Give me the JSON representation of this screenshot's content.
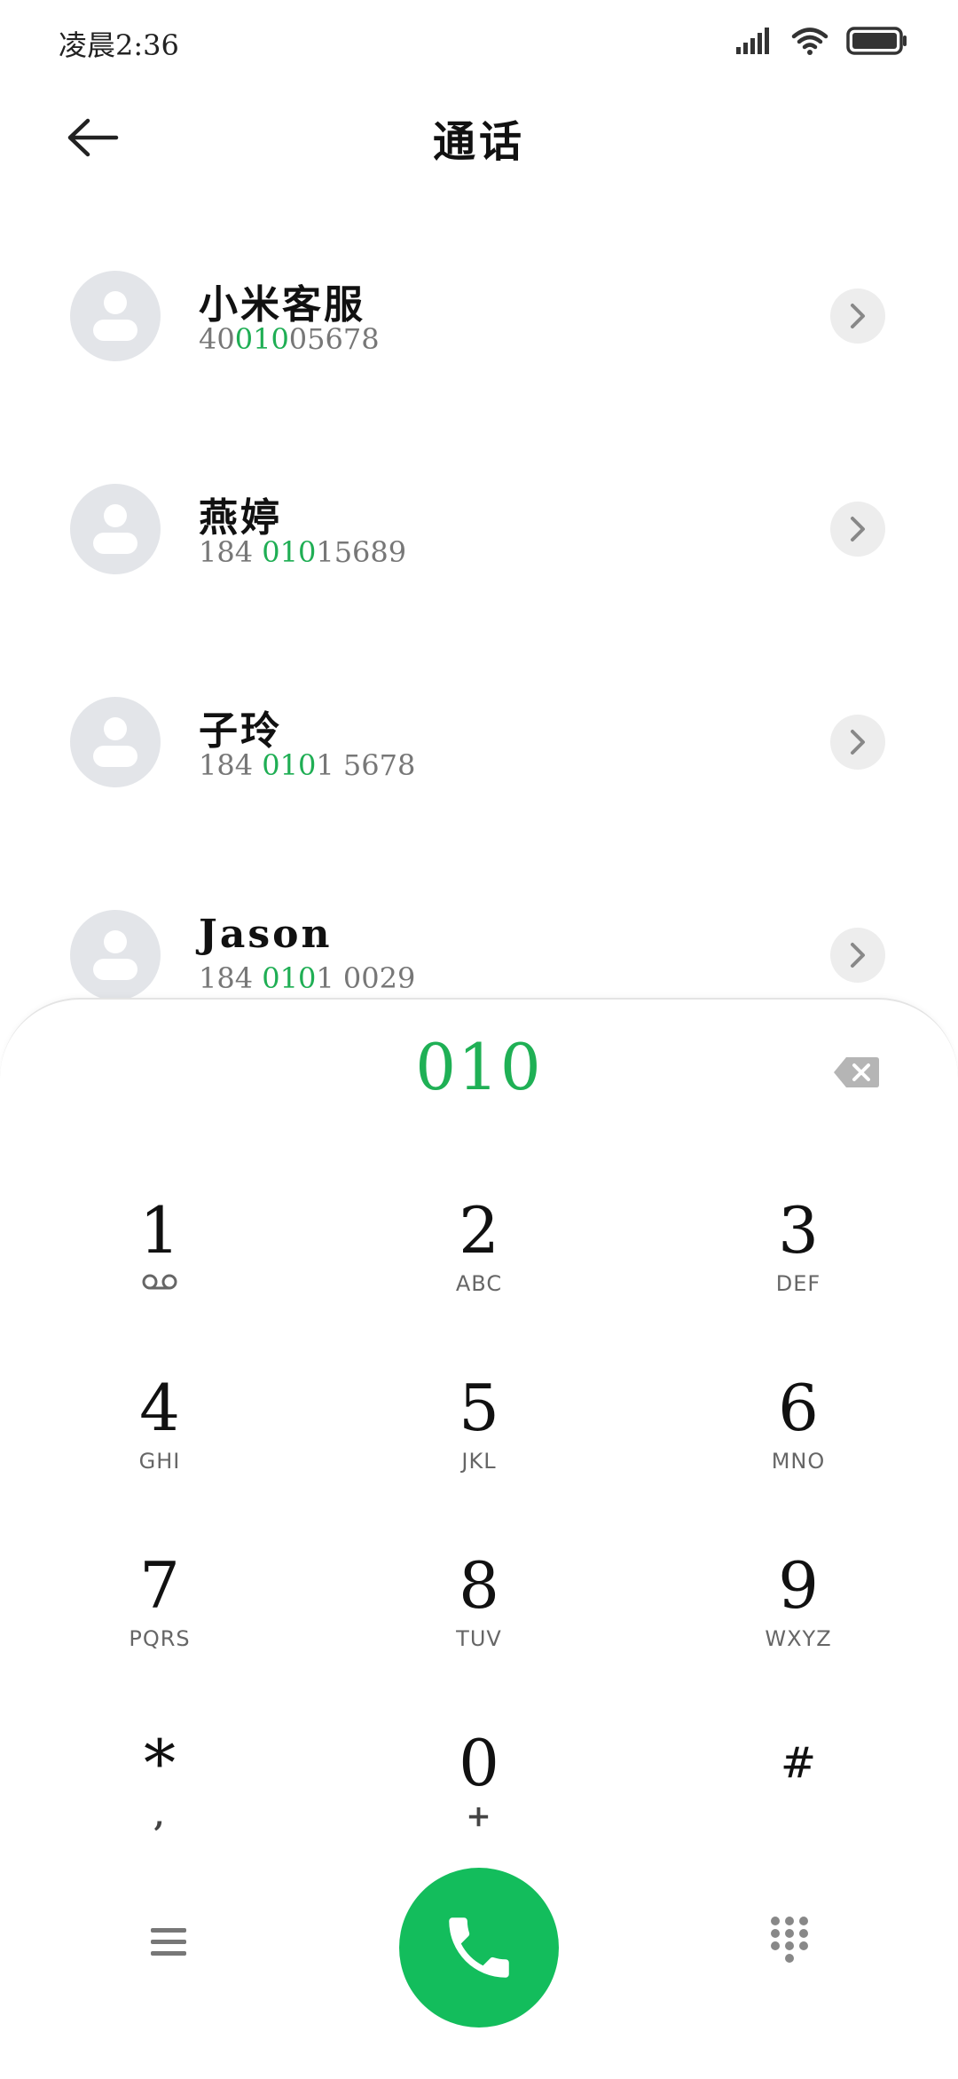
{
  "status_bar": {
    "time": "凌晨2:36",
    "icons": [
      "signal-icon",
      "wifi-icon",
      "battery-icon"
    ]
  },
  "header": {
    "back_icon": "arrow-left-icon",
    "title": "通话"
  },
  "contacts": [
    {
      "name": "小米客服",
      "number_parts": [
        "40",
        "010",
        "05678"
      ]
    },
    {
      "name": "燕婷",
      "number_parts": [
        "184 ",
        "010",
        "15689"
      ]
    },
    {
      "name": "子玲",
      "number_parts": [
        "184 ",
        "010",
        "1 5678"
      ]
    },
    {
      "name": "Jason",
      "number_parts": [
        "184 ",
        "010",
        "1 0029"
      ]
    }
  ],
  "dialer": {
    "input": "010",
    "keys": [
      {
        "digit": "1",
        "sub": ""
      },
      {
        "digit": "2",
        "sub": "ABC"
      },
      {
        "digit": "3",
        "sub": "DEF"
      },
      {
        "digit": "4",
        "sub": "GHI"
      },
      {
        "digit": "5",
        "sub": "JKL"
      },
      {
        "digit": "6",
        "sub": "MNO"
      },
      {
        "digit": "7",
        "sub": "PQRS"
      },
      {
        "digit": "8",
        "sub": "TUV"
      },
      {
        "digit": "9",
        "sub": "WXYZ"
      },
      {
        "digit": "*",
        "sub": ","
      },
      {
        "digit": "0",
        "sub": "+"
      },
      {
        "digit": "#",
        "sub": ""
      }
    ]
  },
  "colors": {
    "accent_green": "#1fb055",
    "call_button": "#13bd5c",
    "avatar_bg": "#e3e5e9"
  }
}
